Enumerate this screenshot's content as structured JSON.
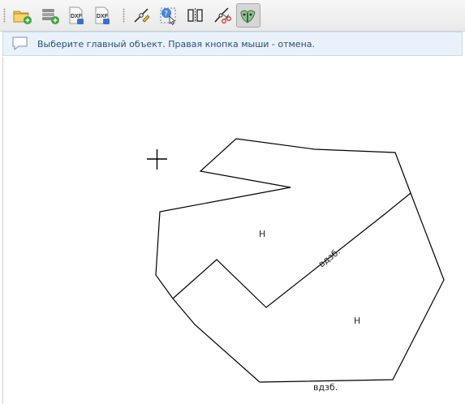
{
  "toolbar": {
    "buttons": [
      {
        "name": "new-layer-button",
        "icon": "folder-add-icon"
      },
      {
        "name": "new-table-button",
        "icon": "database-add-icon"
      },
      {
        "name": "dxf-import-button",
        "icon": "dxf-import-icon",
        "label": "DXF"
      },
      {
        "name": "dxf-export-button",
        "icon": "dxf-export-icon",
        "label": "DXF"
      },
      {
        "name": "edit-node-tool",
        "icon": "node-edit-icon"
      },
      {
        "name": "identify-tool",
        "icon": "identify-help-icon"
      },
      {
        "name": "split-tool",
        "icon": "split-features-icon"
      },
      {
        "name": "cut-tool",
        "icon": "scissors-icon"
      },
      {
        "name": "select-main-object-tool",
        "icon": "merge-shapes-icon",
        "active": true
      }
    ]
  },
  "message": {
    "icon": "speech-bubble-icon",
    "text": "Выберите главный объект. Правая кнопка мыши - отмена."
  },
  "map": {
    "labels": {
      "h1": "Н",
      "h2": "Н",
      "vdzb1": "вдзб.",
      "vdzb2": "вдзб."
    }
  },
  "colors": {
    "accent": "#2a4f7a",
    "message_bg": "#e9f2fb",
    "line": "#000000"
  }
}
